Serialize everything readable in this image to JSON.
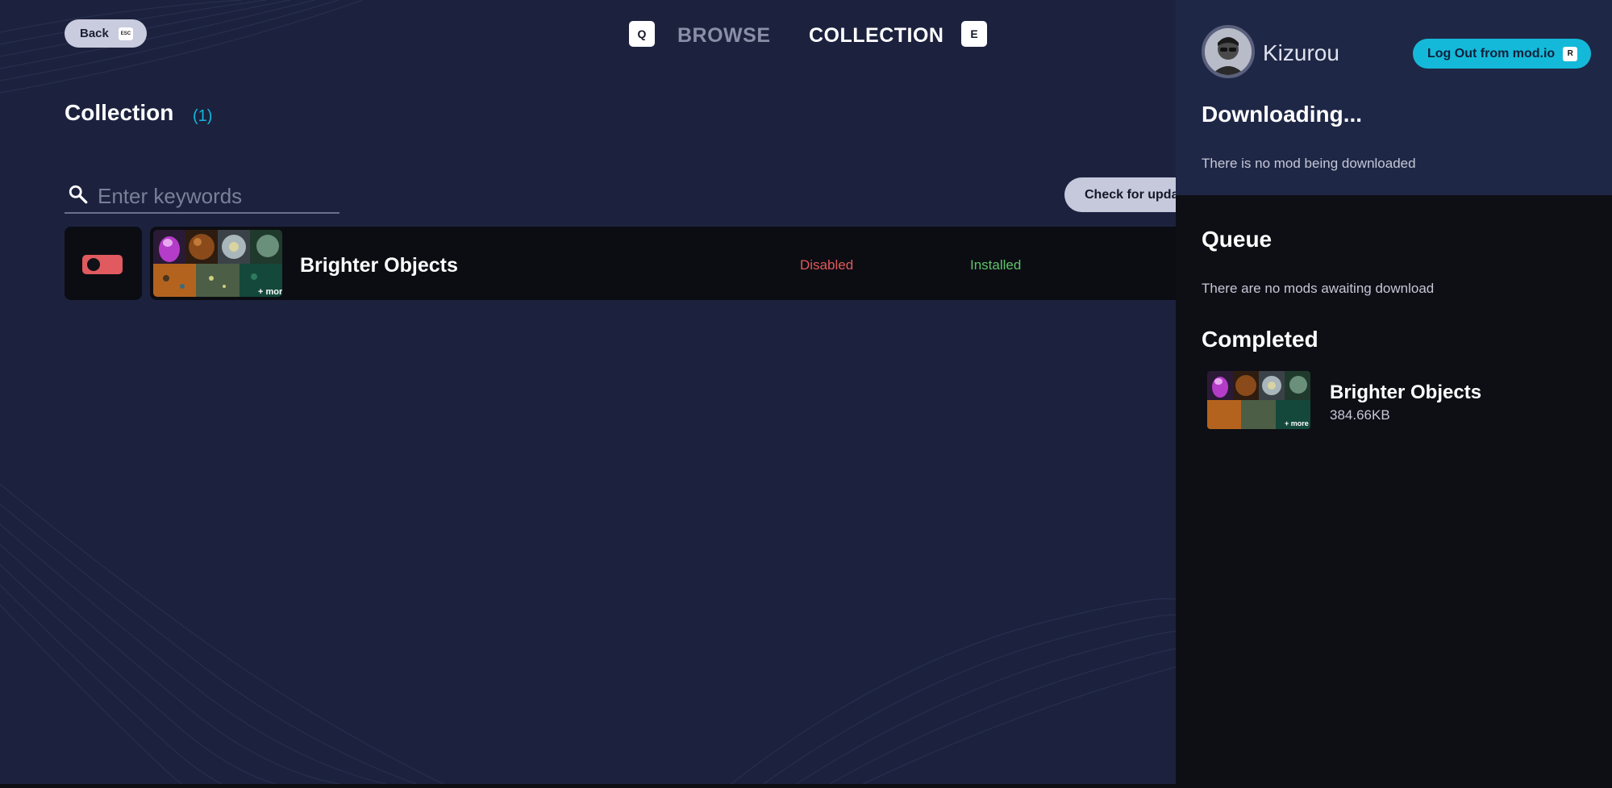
{
  "header": {
    "back_label": "Back",
    "back_key": "ESC",
    "prev_tab_key": "Q",
    "next_tab_key": "E",
    "tabs": [
      {
        "label": "BROWSE",
        "active": false
      },
      {
        "label": "COLLECTION",
        "active": true
      }
    ]
  },
  "collection": {
    "title": "Collection",
    "count": "(1)",
    "search": {
      "placeholder": "Enter keywords",
      "value": ""
    },
    "check_updates_label": "Check for updates",
    "mods": [
      {
        "name": "Brighter Objects",
        "enabled": false,
        "status_enabled": "Disabled",
        "status_install": "Installed",
        "thumb_more": "+ more"
      }
    ]
  },
  "panel": {
    "username": "Kizurou",
    "logout_label": "Log Out from mod.io",
    "logout_key": "R",
    "downloading": {
      "title": "Downloading...",
      "empty_text": "There is no mod being downloaded"
    },
    "queue": {
      "title": "Queue",
      "empty_text": "There are no mods awaiting download"
    },
    "completed": {
      "title": "Completed",
      "items": [
        {
          "name": "Brighter Objects",
          "size": "384.66KB",
          "thumb_more": "+ more"
        }
      ]
    }
  },
  "colors": {
    "background": "#1c223e",
    "accent": "#14b9d9",
    "disabled": "#df5a5a",
    "installed": "#5cc46a",
    "panel_top": "#1f2746",
    "panel_bottom": "#0e0f15"
  }
}
